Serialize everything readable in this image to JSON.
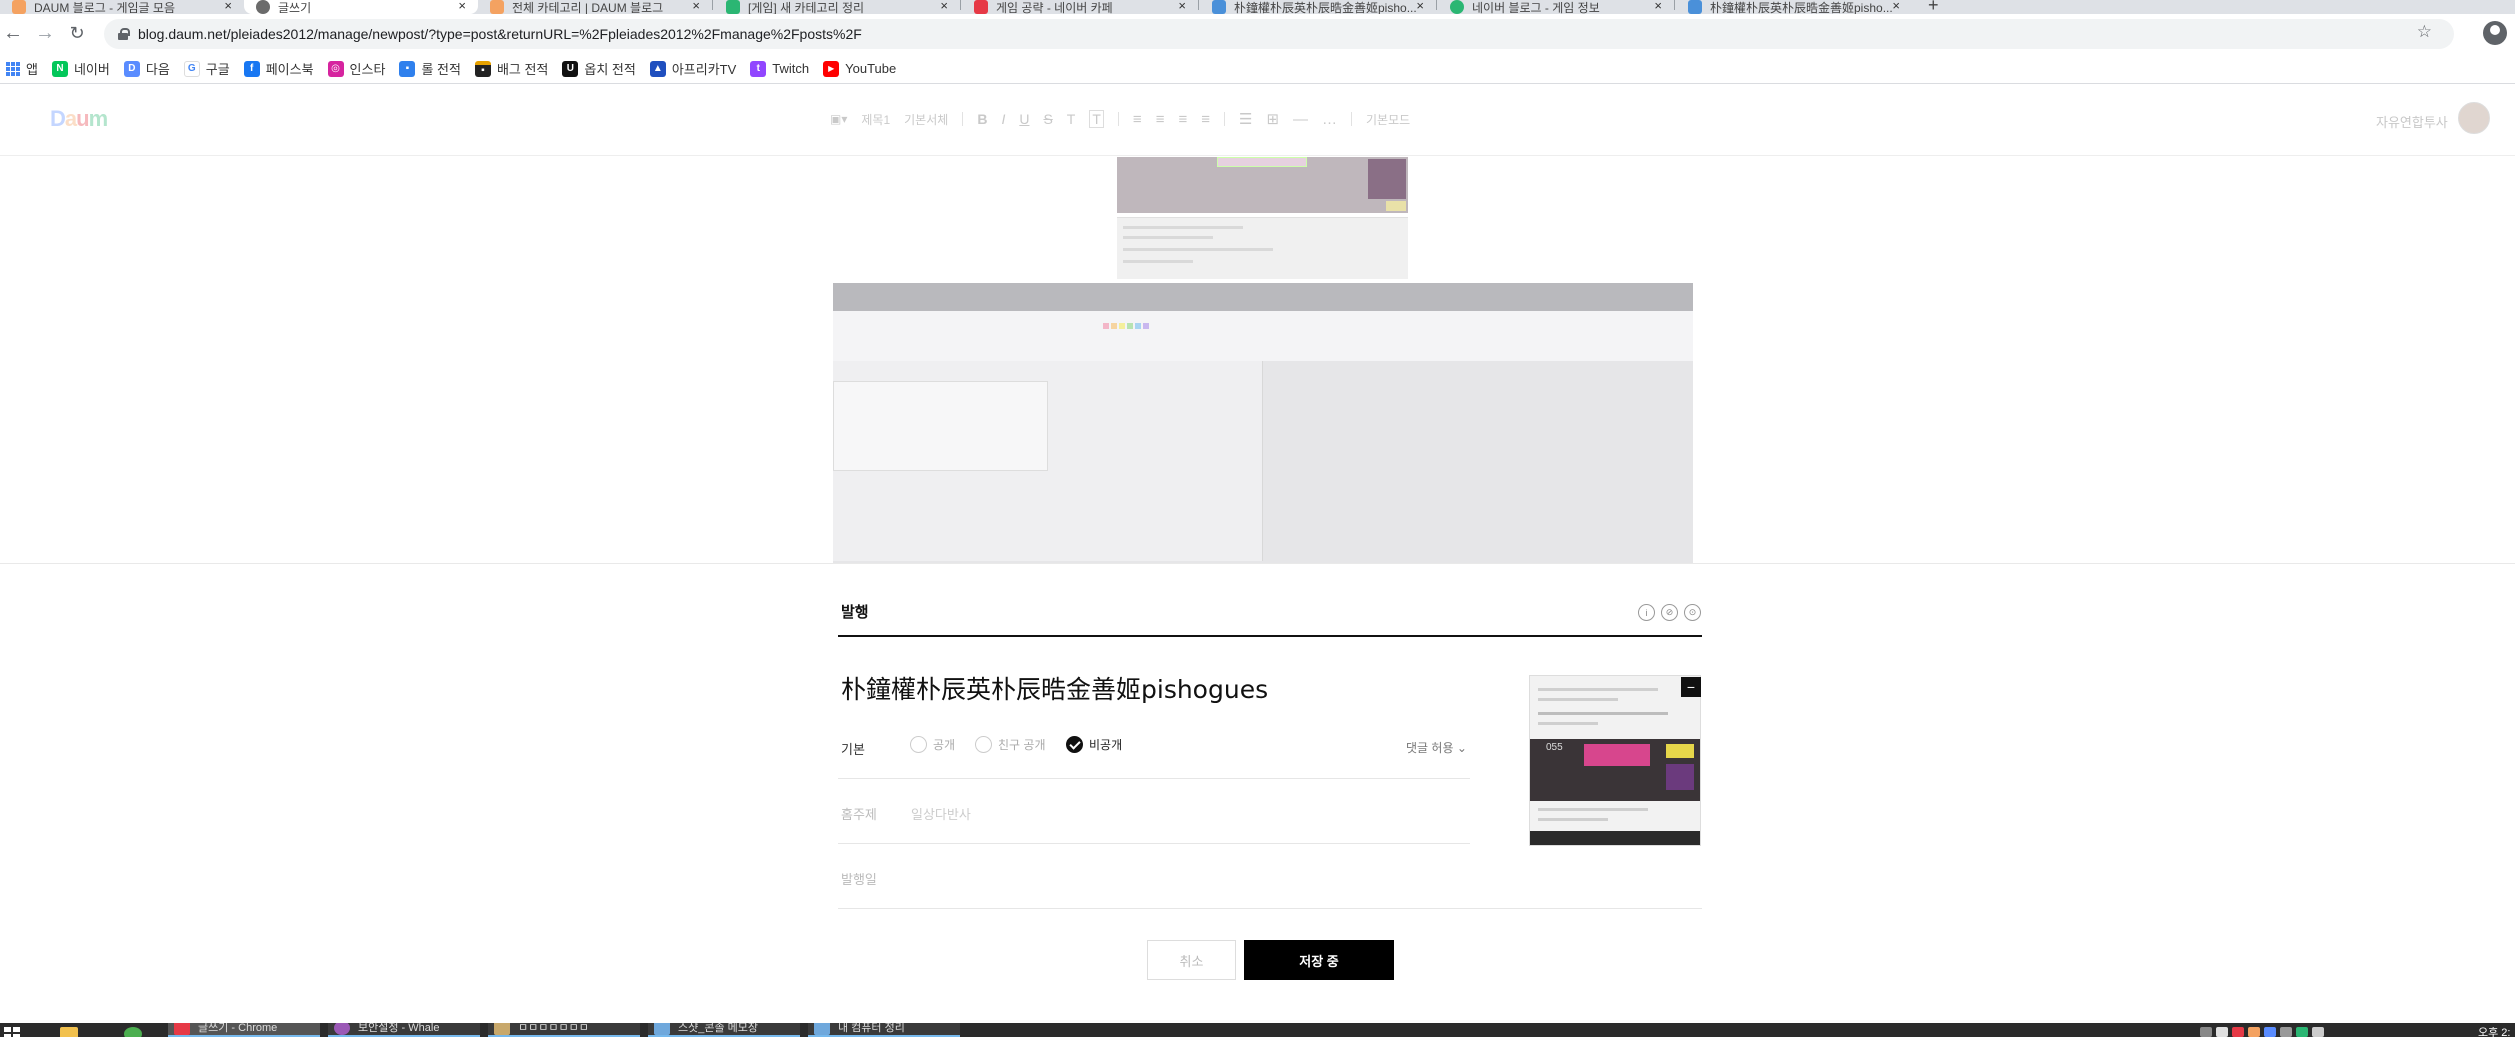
{
  "browser": {
    "tabs": [
      {
        "title": "DAUM 블로그 - 게임글 모음",
        "favicon_color": "#f4a261"
      },
      {
        "title": "글쓰기",
        "favicon_color": "#6b6b6b",
        "active": true
      },
      {
        "title": "전체 카테고리 | DAUM 블로그",
        "favicon_color": "#f4a261"
      },
      {
        "title": "[게임] 새 카테고리 정리",
        "favicon_color": "#2bb673"
      },
      {
        "title": "게임 공략 - 네이버 카페",
        "favicon_color": "#e63946"
      },
      {
        "title": "朴鐘權朴辰英朴辰晧金善姬pisho...",
        "favicon_color": "#4a90d9"
      },
      {
        "title": "네이버 블로그 - 게임 정보",
        "favicon_color": "#2bb673"
      },
      {
        "title": "朴鐘權朴辰英朴辰晧金善姬pisho...",
        "favicon_color": "#4a90d9"
      }
    ],
    "new_tab_glyph": "+",
    "url": "blog.daum.net/pleiades2012/manage/newpost/?type=post&returnURL=%2Fpleiades2012%2Fmanage%2Fposts%2F",
    "bookmarks": [
      {
        "label": "앱",
        "color": "#4285f4",
        "icon": "apps-grid-icon"
      },
      {
        "label": "네이버",
        "color": "#03c75a",
        "glyph": "N"
      },
      {
        "label": "다음",
        "color": "#5a8cff",
        "glyph": "D"
      },
      {
        "label": "구글",
        "color": "#4285f4",
        "glyph": "G"
      },
      {
        "label": "페이스북",
        "color": "#1877f2",
        "glyph": "f"
      },
      {
        "label": "인스타",
        "color": "#d6249f",
        "glyph": "◎"
      },
      {
        "label": "롤 전적",
        "color": "#2f80ed",
        "glyph": "▪"
      },
      {
        "label": "배그 전적",
        "color": "#222222",
        "glyph": "▪"
      },
      {
        "label": "옵치 전적",
        "color": "#111111",
        "glyph": "U"
      },
      {
        "label": "아프리카TV",
        "color": "#1f4fbf",
        "glyph": "▲"
      },
      {
        "label": "Twitch",
        "color": "#9146ff",
        "glyph": "t"
      },
      {
        "label": "YouTube",
        "color": "#ff0000",
        "glyph": "▶"
      }
    ]
  },
  "editor": {
    "logo": "Daum",
    "toolbar": [
      "제목1",
      "기본서체",
      "B",
      "I",
      "U",
      "S",
      "T",
      "T",
      "≡",
      "≡",
      "≡",
      "≡",
      "☰",
      "⊞",
      "—",
      "…",
      "기본모드"
    ],
    "user_name": "자유연합투사"
  },
  "publish": {
    "heading": "발행",
    "icons": [
      "i",
      "⊘",
      "⊙"
    ],
    "post_title": "朴鐘權朴辰英朴辰晧金善姬pishogues",
    "visibility_label": "기본",
    "visibility_options": [
      {
        "label": "공개",
        "checked": false
      },
      {
        "label": "친구 공개",
        "checked": false
      },
      {
        "label": "비공개",
        "checked": true
      }
    ],
    "comment_option": "댓글 허용",
    "topic_label": "홈주제",
    "topic_value": "일상다반사",
    "publish_date_label": "발행일",
    "thumbnail_number": "055",
    "remove_glyph": "−",
    "cancel_label": "취소",
    "save_label": "저장 중"
  },
  "taskbar": {
    "tasks": [
      {
        "label": "글쓰기 - Chrome",
        "active": true
      },
      {
        "label": "보안설정 - Whale",
        "active": false
      },
      {
        "label": "ㅁㅁㅁㅁㅁㅁㅁ",
        "active": false
      },
      {
        "label": "스샷_콘솔 메모장",
        "active": false
      },
      {
        "label": "내 컴퓨터 정리",
        "active": false
      }
    ],
    "clock": "오후 2:"
  }
}
